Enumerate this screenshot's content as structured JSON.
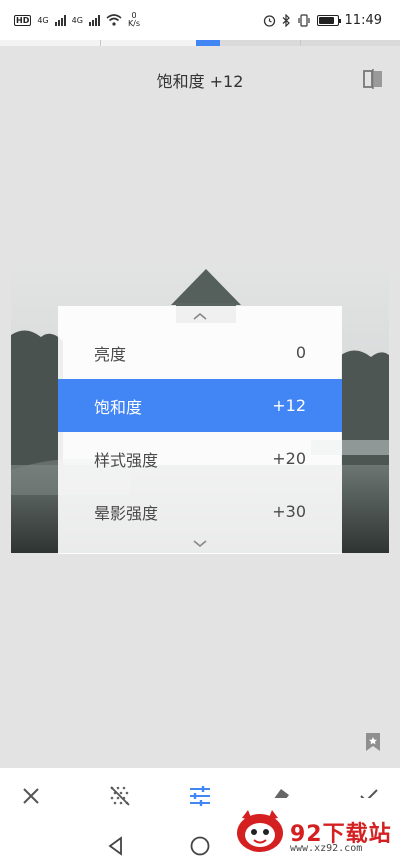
{
  "status_bar": {
    "hd_label": "HD",
    "net_left": "4G",
    "net_right": "4G",
    "speed_value": "0",
    "speed_unit": "K/s",
    "time": "11:49",
    "icons": [
      "alarm-icon",
      "bluetooth-icon",
      "vibrate-icon",
      "battery-icon"
    ]
  },
  "adjust_progress": 0.52,
  "header": {
    "title": "饱和度 +12",
    "compare_icon": "compare-icon"
  },
  "menu": {
    "items": [
      {
        "label": "亮度",
        "value": "0",
        "selected": false
      },
      {
        "label": "饱和度",
        "value": "+12",
        "selected": true
      },
      {
        "label": "样式强度",
        "value": "+20",
        "selected": false
      },
      {
        "label": "晕影强度",
        "value": "+30",
        "selected": false
      }
    ],
    "accent_color": "#4285f4"
  },
  "toolbar": {
    "tools": [
      "close-icon",
      "style-icon",
      "tune-icon",
      "eraser-icon",
      "check-icon"
    ]
  },
  "navbar": {
    "buttons": [
      "back-icon",
      "home-icon"
    ]
  },
  "watermark": {
    "brand": "92下载站",
    "url": "www.xz92.com"
  }
}
